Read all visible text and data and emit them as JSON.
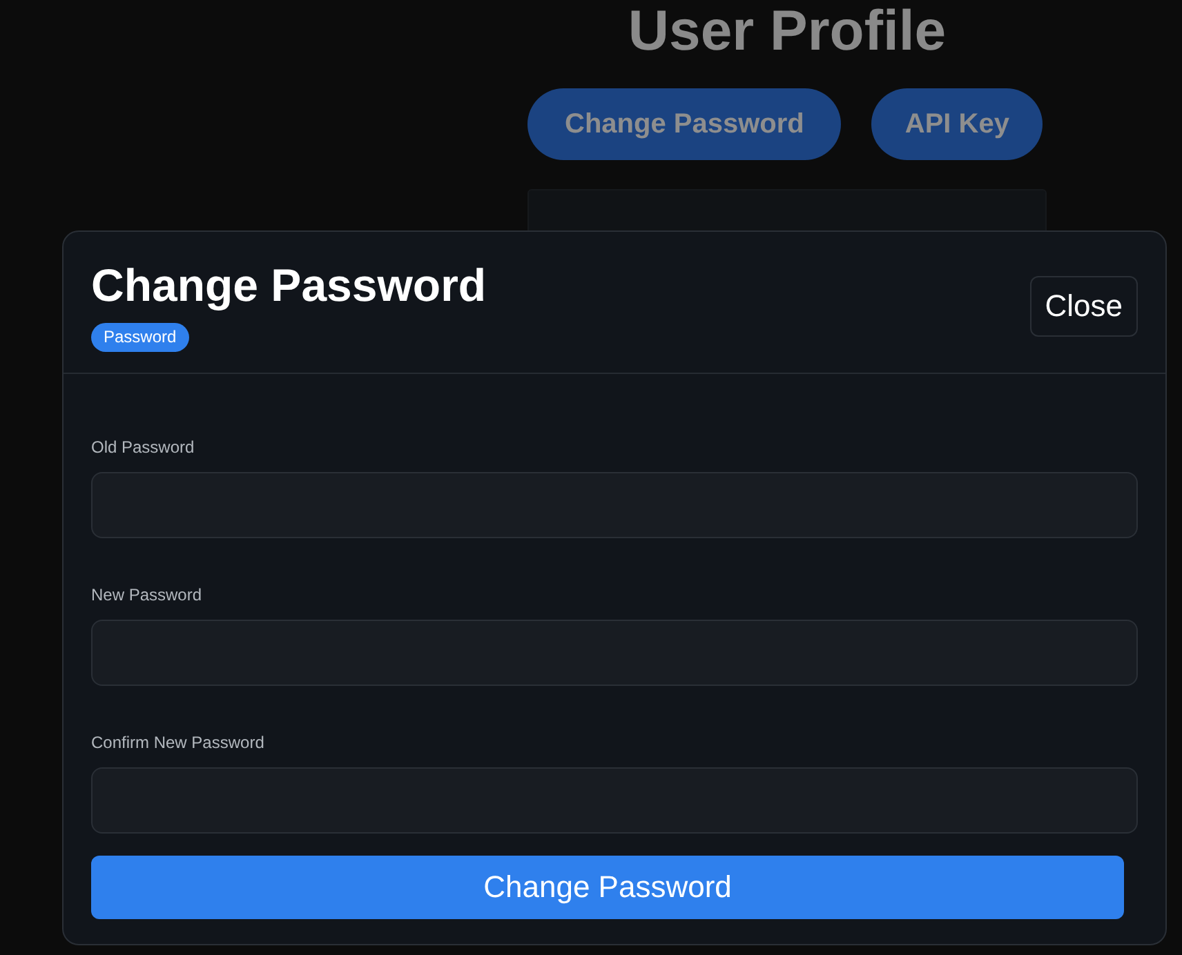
{
  "page": {
    "title": "User Profile",
    "actions": [
      {
        "label": "Change Password"
      },
      {
        "label": "API Key"
      }
    ]
  },
  "dialog": {
    "title": "Change Password",
    "badge": "Password",
    "close_label": "Close",
    "fields": [
      {
        "label": "Old Password"
      },
      {
        "label": "New Password"
      },
      {
        "label": "Confirm New Password"
      }
    ],
    "submit_label": "Change Password"
  }
}
